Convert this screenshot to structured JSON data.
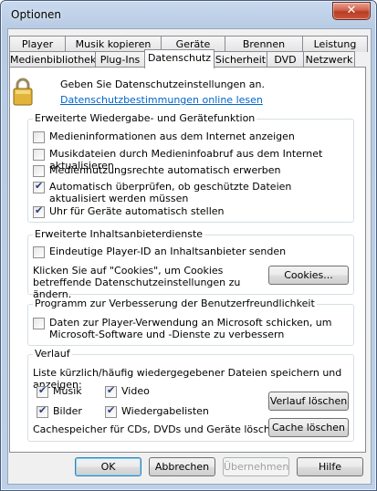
{
  "window": {
    "title": "Optionen",
    "close_symbol": "✕"
  },
  "tabs": {
    "row1": [
      "Player",
      "Musik kopieren",
      "Geräte",
      "Brennen",
      "Leistung"
    ],
    "row2": [
      "Medienbibliothek",
      "Plug-Ins",
      "Datenschutz",
      "Sicherheit",
      "DVD",
      "Netzwerk"
    ],
    "active": "Datenschutz"
  },
  "header": {
    "intro": "Geben Sie Datenschutzeinstellungen an.",
    "link": "Datenschutzbestimmungen online lesen",
    "icon": "lock-icon"
  },
  "group_playback": {
    "title": "Erweiterte Wiedergabe- und Gerätefunktion",
    "items": [
      {
        "label": "Medieninformationen aus dem Internet anzeigen",
        "checked": false
      },
      {
        "label": "Musikdateien durch Medieninfoabruf aus dem Internet aktualisieren",
        "checked": false
      },
      {
        "label": "Mediennutzungsrechte automatisch erwerben",
        "checked": false
      },
      {
        "label": "Automatisch überprüfen, ob geschützte Dateien aktualisiert werden müssen",
        "checked": true
      },
      {
        "label": "Uhr für Geräte automatisch stellen",
        "checked": true
      }
    ]
  },
  "group_providers": {
    "title": "Erweiterte Inhaltsanbieterdienste",
    "player_id_label": "Eindeutige Player-ID an Inhaltsanbieter senden",
    "player_id_checked": false,
    "cookies_text": "Klicken Sie auf \"Cookies\", um Cookies betreffende Datenschutzeinstellungen zu ändern.",
    "cookies_button": "Cookies..."
  },
  "group_improvement": {
    "title": "Programm zur Verbesserung der Benutzerfreundlichkeit",
    "label": "Daten zur Player-Verwendung an Microsoft schicken, um Microsoft-Software und -Dienste zu verbessern",
    "checked": false
  },
  "group_history": {
    "title": "Verlauf",
    "description": "Liste kürzlich/häufig wiedergegebener Dateien speichern und anzeigen:",
    "items": [
      {
        "label": "Musik",
        "checked": true
      },
      {
        "label": "Video",
        "checked": true
      },
      {
        "label": "Bilder",
        "checked": true
      },
      {
        "label": "Wiedergabelisten",
        "checked": true
      }
    ],
    "clear_history_button": "Verlauf löschen",
    "cache_text": "Cachespeicher für CDs, DVDs und Geräte löschen.",
    "clear_cache_button": "Cache löschen"
  },
  "footer": {
    "ok": "OK",
    "cancel": "Abbrechen",
    "apply": "Übernehmen",
    "help": "Hilfe"
  }
}
